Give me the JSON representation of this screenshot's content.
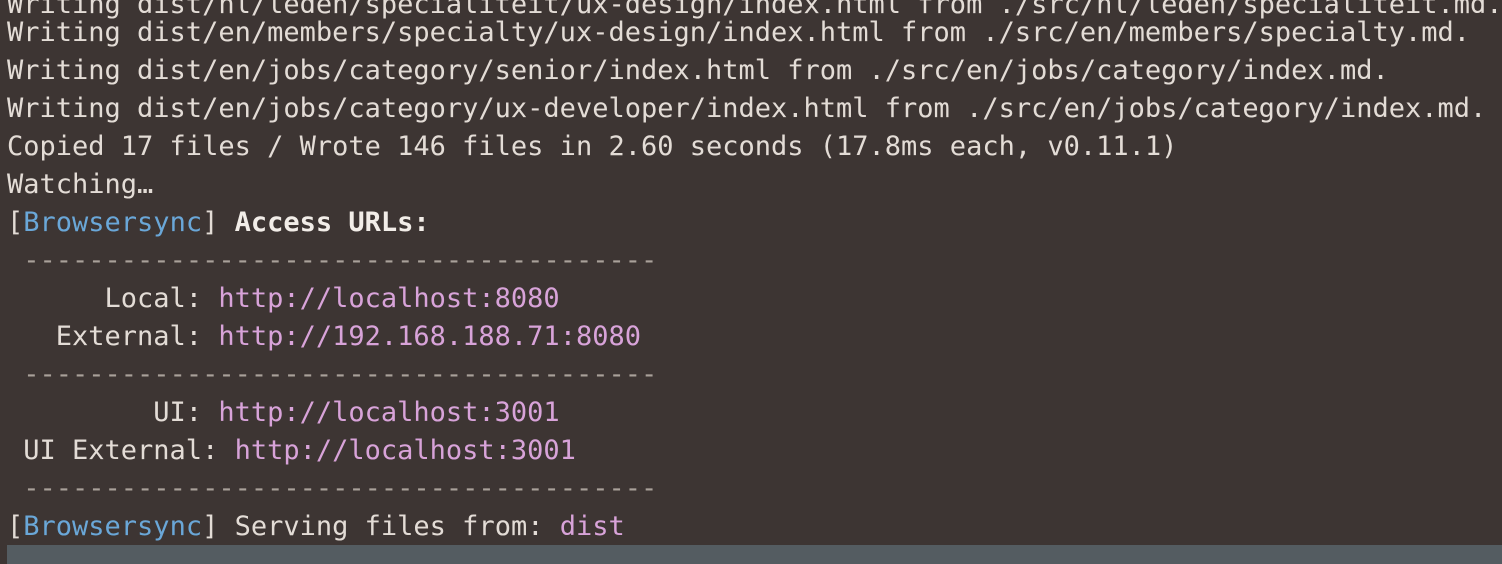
{
  "terminal": {
    "lines": {
      "l0": "Writing dist/nl/leden/specialiteit/ux-design/index.html from ./src/nl/leden/specialiteit.md.",
      "l1": "Writing dist/en/members/specialty/ux-design/index.html from ./src/en/members/specialty.md.",
      "l2": "Writing dist/en/jobs/category/senior/index.html from ./src/en/jobs/category/index.md.",
      "l3": "Writing dist/en/jobs/category/ux-developer/index.html from ./src/en/jobs/category/index.md.",
      "l4": "Copied 17 files / Wrote 146 files in 2.60 seconds (17.8ms each, v0.11.1)",
      "l5": "Watching…"
    },
    "browsersync": {
      "open_bracket": "[",
      "tag": "Browsersync",
      "close_bracket": "]",
      "access_heading": "Access URLs:",
      "divider": "---------------------------------------",
      "local_label": "      Local: ",
      "local_url": "http://localhost:8080",
      "external_label": "   External: ",
      "external_url": "http://192.168.188.71:8080",
      "ui_label": "         UI: ",
      "ui_url": "http://localhost:3001",
      "ui_external_label": " UI External: ",
      "ui_external_url": "http://localhost:3001",
      "serving_text": "Serving files from: ",
      "serving_dir": "dist"
    }
  }
}
